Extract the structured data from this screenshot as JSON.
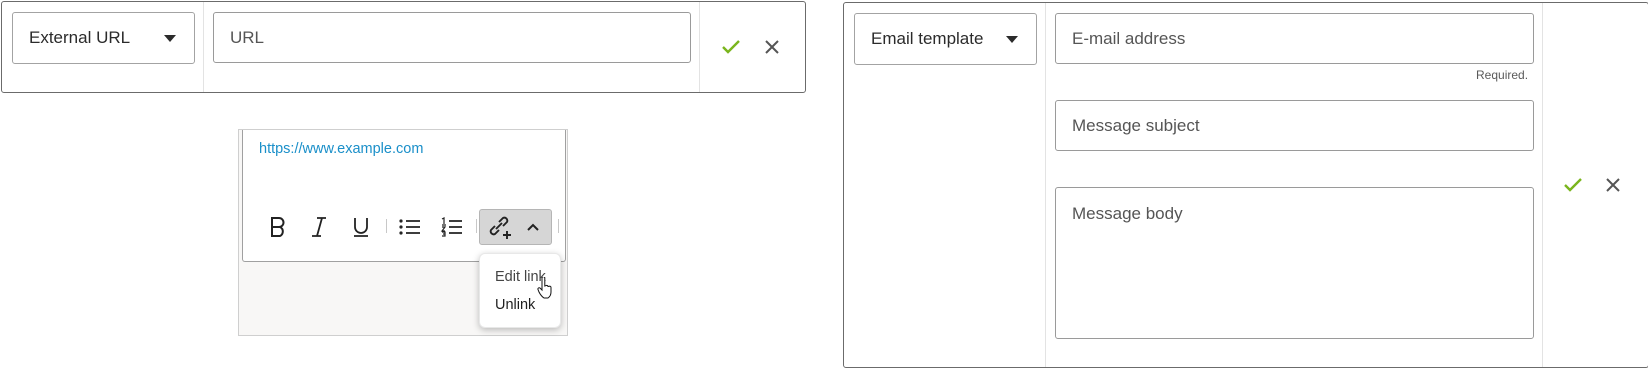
{
  "url_panel": {
    "link_type": "External URL",
    "url_placeholder": "URL",
    "url_value": "",
    "icons": {
      "confirm": "check-icon",
      "cancel": "close-icon"
    }
  },
  "editor": {
    "link_text": "https://www.example.com",
    "toolbar": [
      "bold-icon",
      "italic-icon",
      "underline-icon",
      "bullet-list-icon",
      "numbered-list-icon",
      "link-icon",
      "chevron-up-icon"
    ],
    "link_menu": {
      "edit": "Edit link",
      "unlink": "Unlink"
    }
  },
  "email_panel": {
    "link_type": "Email template",
    "email_placeholder": "E-mail address",
    "email_helper": "Required.",
    "subject_placeholder": "Message subject",
    "body_placeholder": "Message body"
  },
  "colors": {
    "confirm_green": "#7ab51d",
    "cancel_gray": "#555555",
    "link_blue": "#1a8fc9"
  }
}
